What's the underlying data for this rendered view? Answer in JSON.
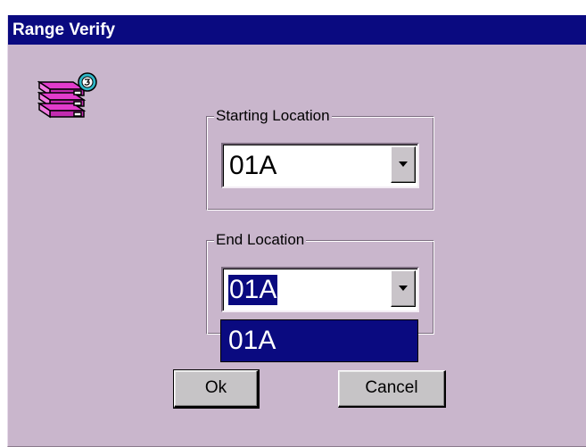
{
  "window": {
    "title": "Range Verify"
  },
  "app_icon": {
    "name": "shelving-verify-icon",
    "colors": {
      "shelf": "#e23ccc",
      "badge": "#2fb7c7"
    }
  },
  "starting_location": {
    "label": "Starting Location",
    "value": "01A"
  },
  "end_location": {
    "label": "End Location",
    "value": "01A",
    "dropdown_options": [
      "01A"
    ]
  },
  "buttons": {
    "ok_label": "Ok",
    "cancel_label": "Cancel"
  },
  "colors": {
    "title_bar": "#0a0a80",
    "dialog_background": "#c9b6cc",
    "selection": "#0a0a80"
  }
}
